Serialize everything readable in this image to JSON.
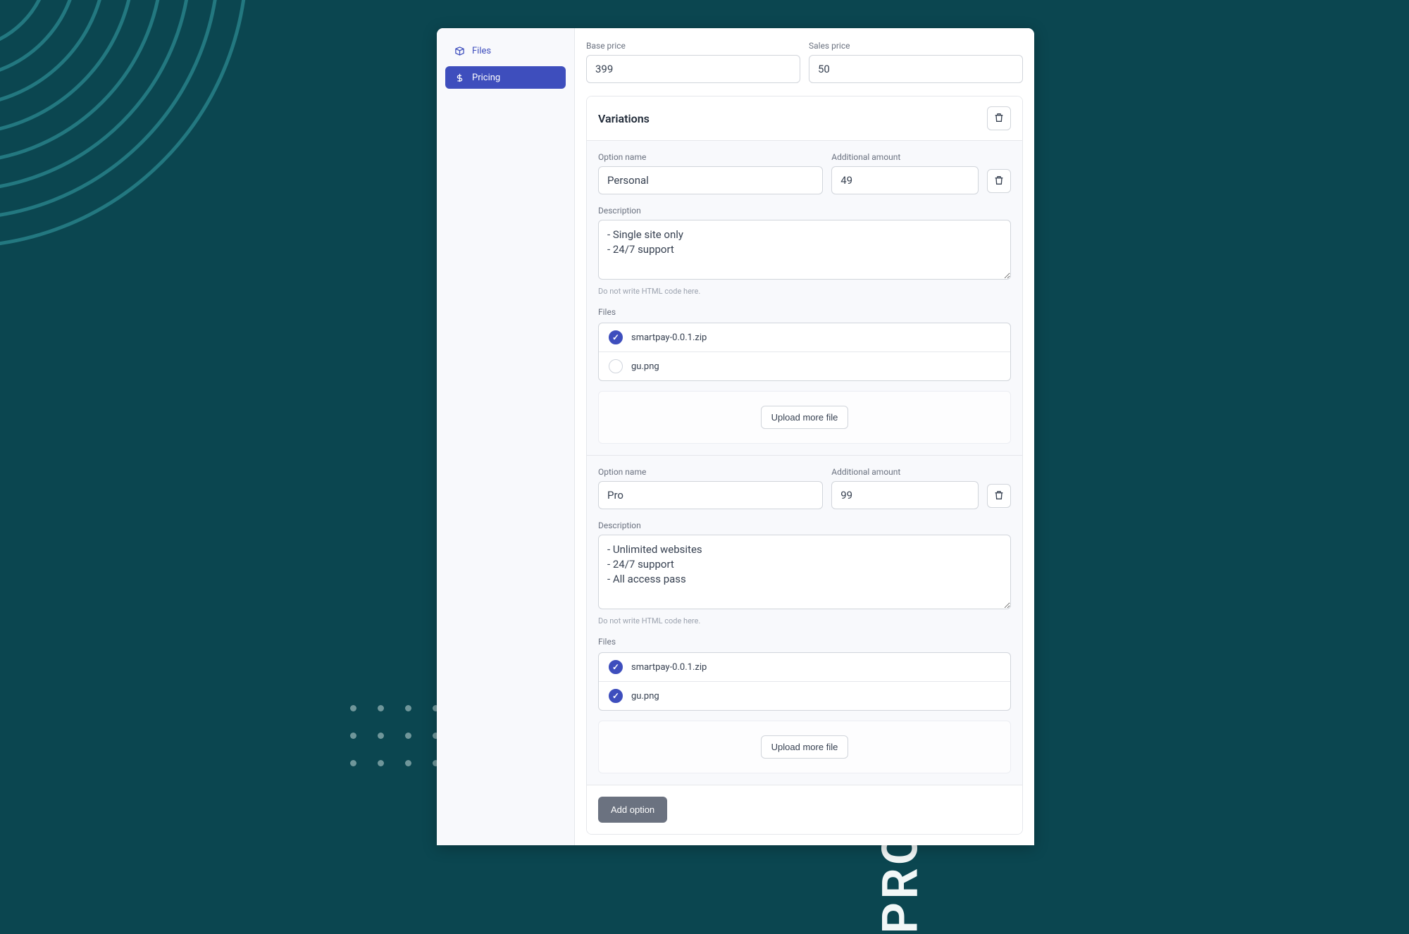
{
  "page_title": "PRODUCT VARIATIONS",
  "sidebar": {
    "items": [
      {
        "label": "Files",
        "icon_name": "box-icon"
      },
      {
        "label": "Pricing",
        "icon_name": "dollar-icon"
      }
    ]
  },
  "pricing": {
    "base_label": "Base price",
    "base_value": "399",
    "sales_label": "Sales price",
    "sales_value": "50"
  },
  "variations_heading": "Variations",
  "labels": {
    "option_name": "Option name",
    "additional_amount": "Additional amount",
    "description": "Description",
    "description_helper": "Do not write HTML code here.",
    "files": "Files",
    "upload_more": "Upload more file",
    "add_option": "Add option"
  },
  "variations": [
    {
      "name": "Personal",
      "amount": "49",
      "description": "- Single site only\n- 24/7 support",
      "files": [
        {
          "name": "smartpay-0.0.1.zip",
          "selected": true
        },
        {
          "name": "gu.png",
          "selected": false
        }
      ]
    },
    {
      "name": "Pro",
      "amount": "99",
      "description": "- Unlimited websites\n- 24/7 support\n- All access pass",
      "files": [
        {
          "name": "smartpay-0.0.1.zip",
          "selected": true
        },
        {
          "name": "gu.png",
          "selected": true
        }
      ]
    }
  ]
}
